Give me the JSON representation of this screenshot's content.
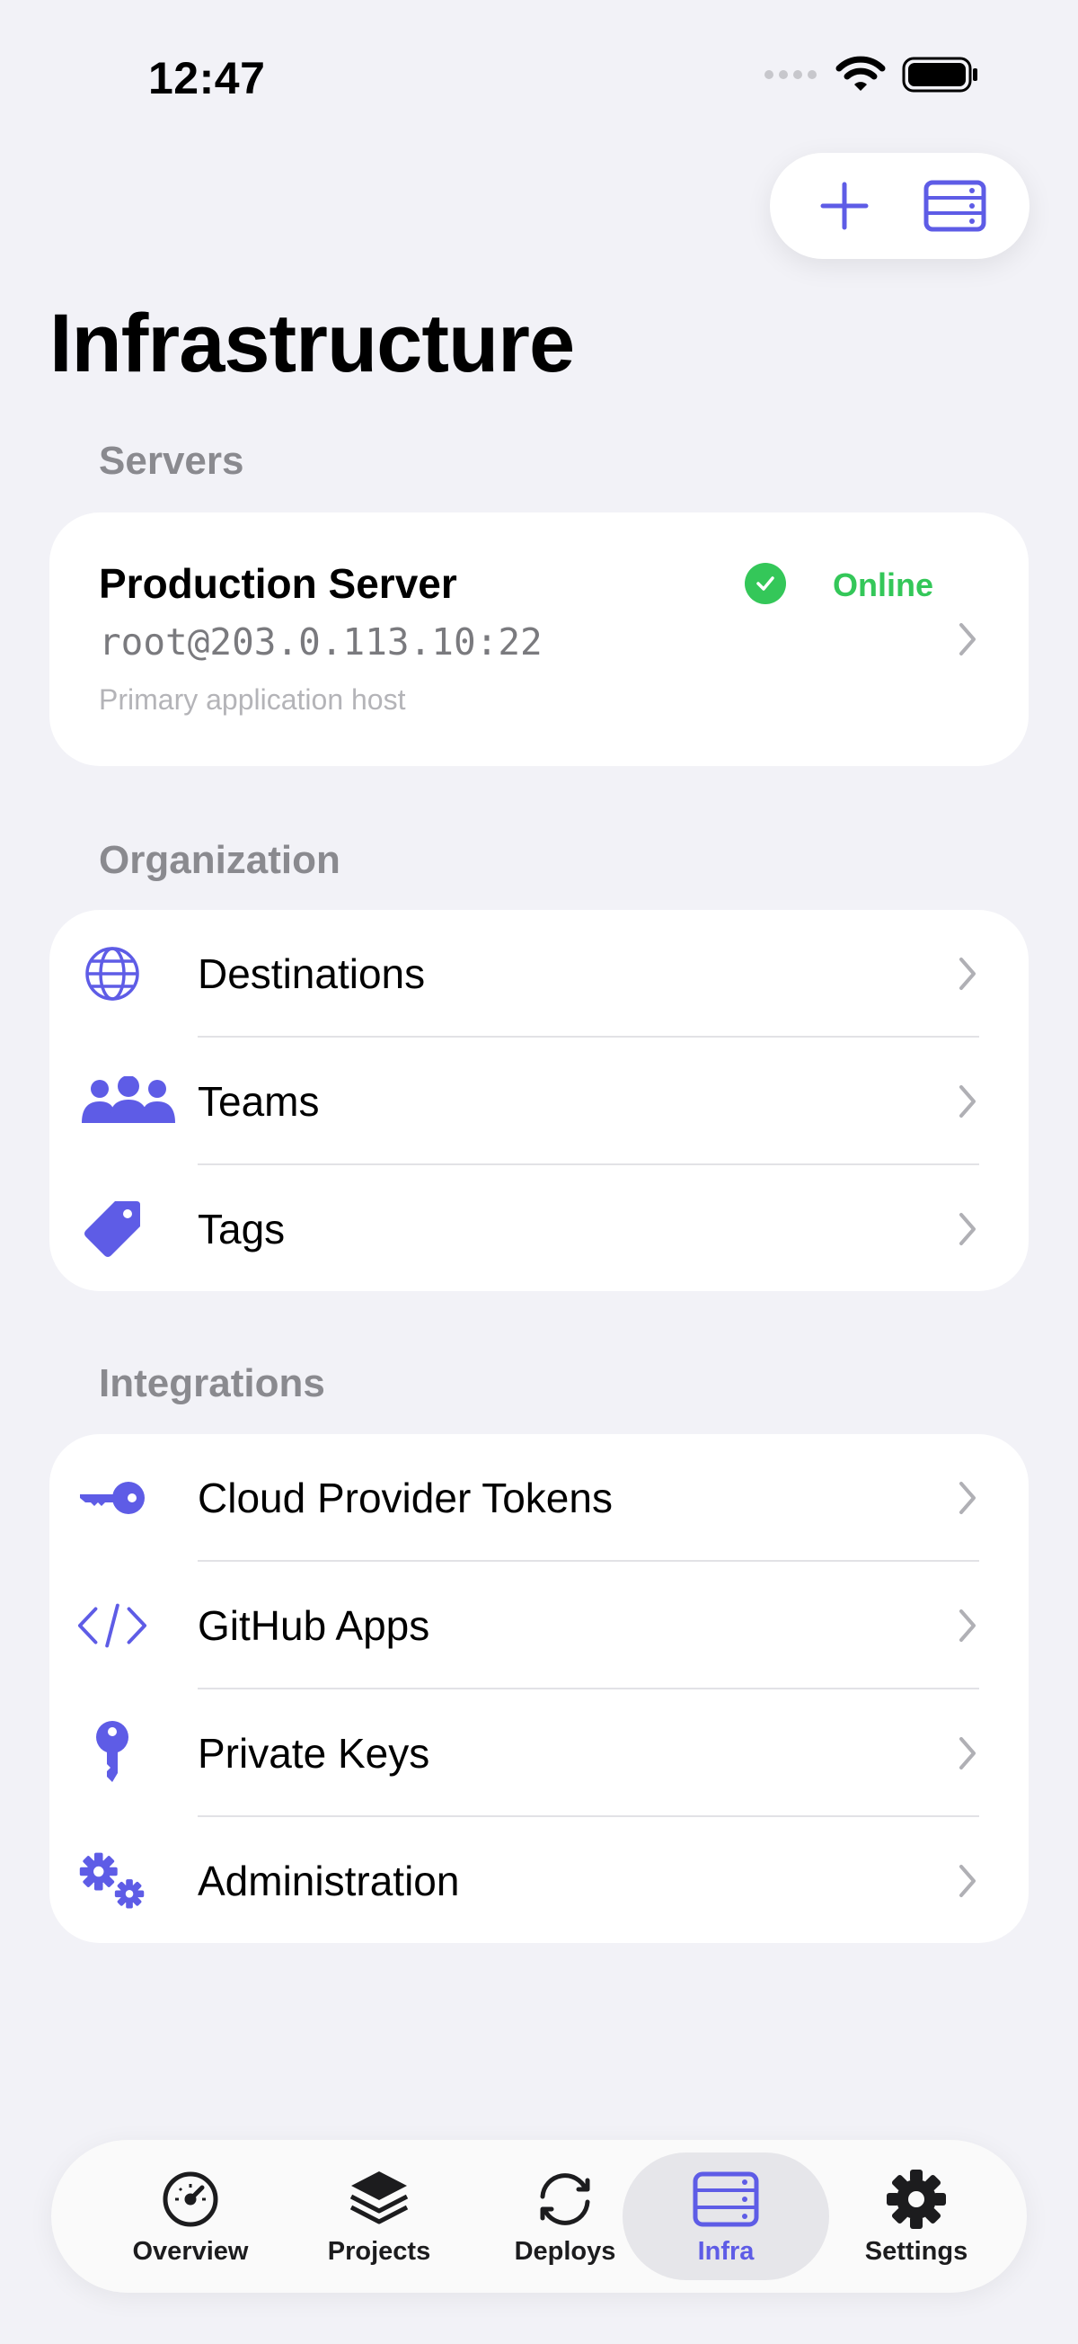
{
  "status_bar": {
    "time": "12:47"
  },
  "top_actions": {
    "add_icon": "plus-icon",
    "server_icon": "server-stack-icon"
  },
  "title": "Infrastructure",
  "servers_section": {
    "header": "Servers",
    "server": {
      "name": "Production Server",
      "address": "root@203.0.113.10:22",
      "description": "Primary application host",
      "status": "Online"
    }
  },
  "organization_section": {
    "header": "Organization",
    "items": [
      {
        "label": "Destinations",
        "icon": "globe-icon"
      },
      {
        "label": "Teams",
        "icon": "people-icon"
      },
      {
        "label": "Tags",
        "icon": "tag-icon"
      }
    ]
  },
  "integrations_section": {
    "header": "Integrations",
    "items": [
      {
        "label": "Cloud Provider Tokens",
        "icon": "key-horizontal-icon"
      },
      {
        "label": "GitHub Apps",
        "icon": "code-brackets-icon"
      },
      {
        "label": "Private Keys",
        "icon": "key-vertical-icon"
      },
      {
        "label": "Administration",
        "icon": "gears-icon"
      }
    ]
  },
  "tab_bar": {
    "tabs": [
      {
        "label": "Overview",
        "icon": "speedometer-icon"
      },
      {
        "label": "Projects",
        "icon": "stack-icon"
      },
      {
        "label": "Deploys",
        "icon": "refresh-icon"
      },
      {
        "label": "Infra",
        "icon": "server-stack-icon",
        "active": true
      },
      {
        "label": "Settings",
        "icon": "gear-icon"
      }
    ]
  },
  "colors": {
    "accent": "#5e5ce6",
    "online": "#34c759",
    "background": "#f2f2f7"
  }
}
